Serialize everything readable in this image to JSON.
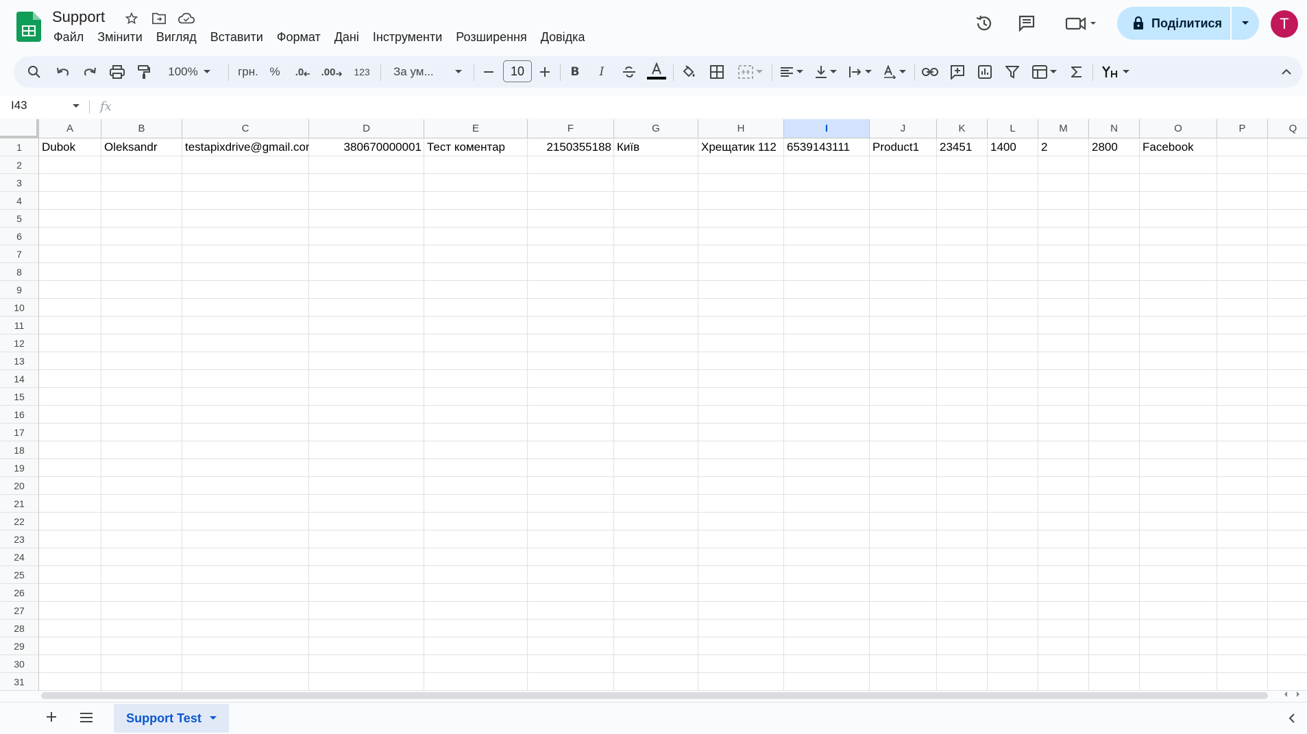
{
  "app": {
    "title": "Support",
    "menu": [
      "Файл",
      "Змінити",
      "Вигляд",
      "Вставити",
      "Формат",
      "Дані",
      "Інструменти",
      "Розширення",
      "Довідка"
    ],
    "share_label": "Поділитися",
    "avatar_letter": "T",
    "accent_color": "#0b57d0",
    "logo_color": "#0f9d58"
  },
  "toolbar": {
    "zoom": "100%",
    "currency": "грн.",
    "percent": "%",
    "dec_decrease": ".0",
    "dec_increase": ".00",
    "format_123": "123",
    "font_family": "За ум...",
    "font_size": "10"
  },
  "formula_bar": {
    "name_box": "I43",
    "fx": "fx",
    "formula": ""
  },
  "grid": {
    "columns": [
      "A",
      "B",
      "C",
      "D",
      "E",
      "F",
      "G",
      "H",
      "I",
      "J",
      "K",
      "L",
      "M",
      "N",
      "O",
      "P",
      "Q"
    ],
    "selected_column": "I",
    "row_numbers": [
      "1",
      "2",
      "3",
      "4",
      "5",
      "6",
      "7",
      "8",
      "9",
      "10",
      "11",
      "12",
      "13",
      "14",
      "15",
      "16",
      "17",
      "18",
      "19",
      "20",
      "21",
      "22",
      "23",
      "24",
      "25",
      "26",
      "27",
      "28",
      "29",
      "30",
      "31"
    ],
    "row1": [
      "Dubok",
      "Oleksandr",
      "testapixdrive@gmail.con",
      "380670000001",
      "Тест коментар",
      "2150355188",
      "Київ",
      "Хрещатик 112",
      "6539143111",
      "Product1",
      "23451",
      "1400",
      "2",
      "2800",
      "Facebook",
      "",
      ""
    ]
  },
  "sheets": {
    "tabs": [
      "Support Test"
    ]
  }
}
